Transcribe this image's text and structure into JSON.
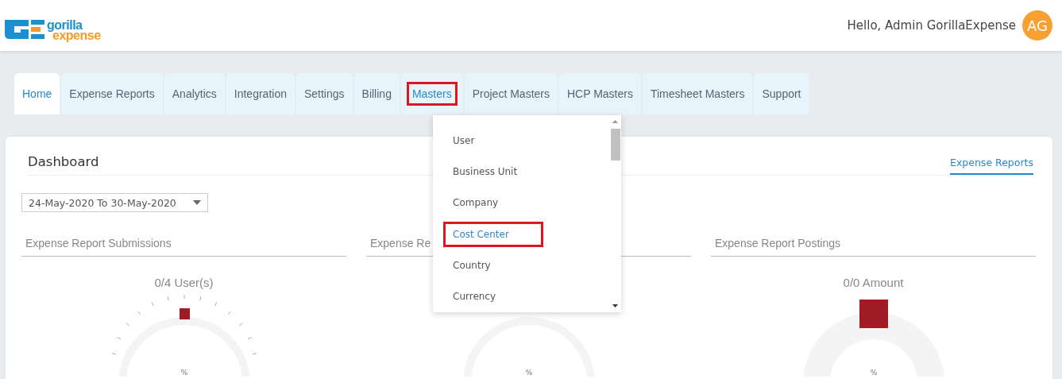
{
  "logo": {
    "top": "gorilla",
    "bottom": "expense"
  },
  "user": {
    "greeting": "Hello, Admin GorillaExpense",
    "initials": "AG"
  },
  "tabs": [
    {
      "label": "Home",
      "selected": true,
      "highlighted": false
    },
    {
      "label": "Expense Reports",
      "selected": false,
      "highlighted": false
    },
    {
      "label": "Analytics",
      "selected": false,
      "highlighted": false
    },
    {
      "label": "Integration",
      "selected": false,
      "highlighted": false
    },
    {
      "label": "Settings",
      "selected": false,
      "highlighted": false
    },
    {
      "label": "Billing",
      "selected": false,
      "highlighted": false
    },
    {
      "label": "Masters",
      "selected": false,
      "highlighted": true
    },
    {
      "label": "Project Masters",
      "selected": false,
      "highlighted": false
    },
    {
      "label": "HCP Masters",
      "selected": false,
      "highlighted": false
    },
    {
      "label": "Timesheet Masters",
      "selected": false,
      "highlighted": false
    },
    {
      "label": "Support",
      "selected": false,
      "highlighted": false
    }
  ],
  "menu": [
    {
      "label": "User",
      "highlighted": false
    },
    {
      "label": "Business Unit",
      "highlighted": false
    },
    {
      "label": "Company",
      "highlighted": false
    },
    {
      "label": "Cost Center",
      "highlighted": true
    },
    {
      "label": "Country",
      "highlighted": false
    },
    {
      "label": "Currency",
      "highlighted": false
    }
  ],
  "dashboard": {
    "title": "Dashboard",
    "link": "Expense Reports",
    "date_range": "24-May-2020 To 30-May-2020",
    "panels": [
      {
        "title": "Expense Report Submissions",
        "label": "0/4 User(s)",
        "kind": "ticks",
        "unit": "%"
      },
      {
        "title": "Expense Re",
        "kind": "ring",
        "unit": "%"
      },
      {
        "title": "Expense Report Postings",
        "label": "0/0 Amount",
        "kind": "block",
        "unit": "%"
      }
    ]
  }
}
